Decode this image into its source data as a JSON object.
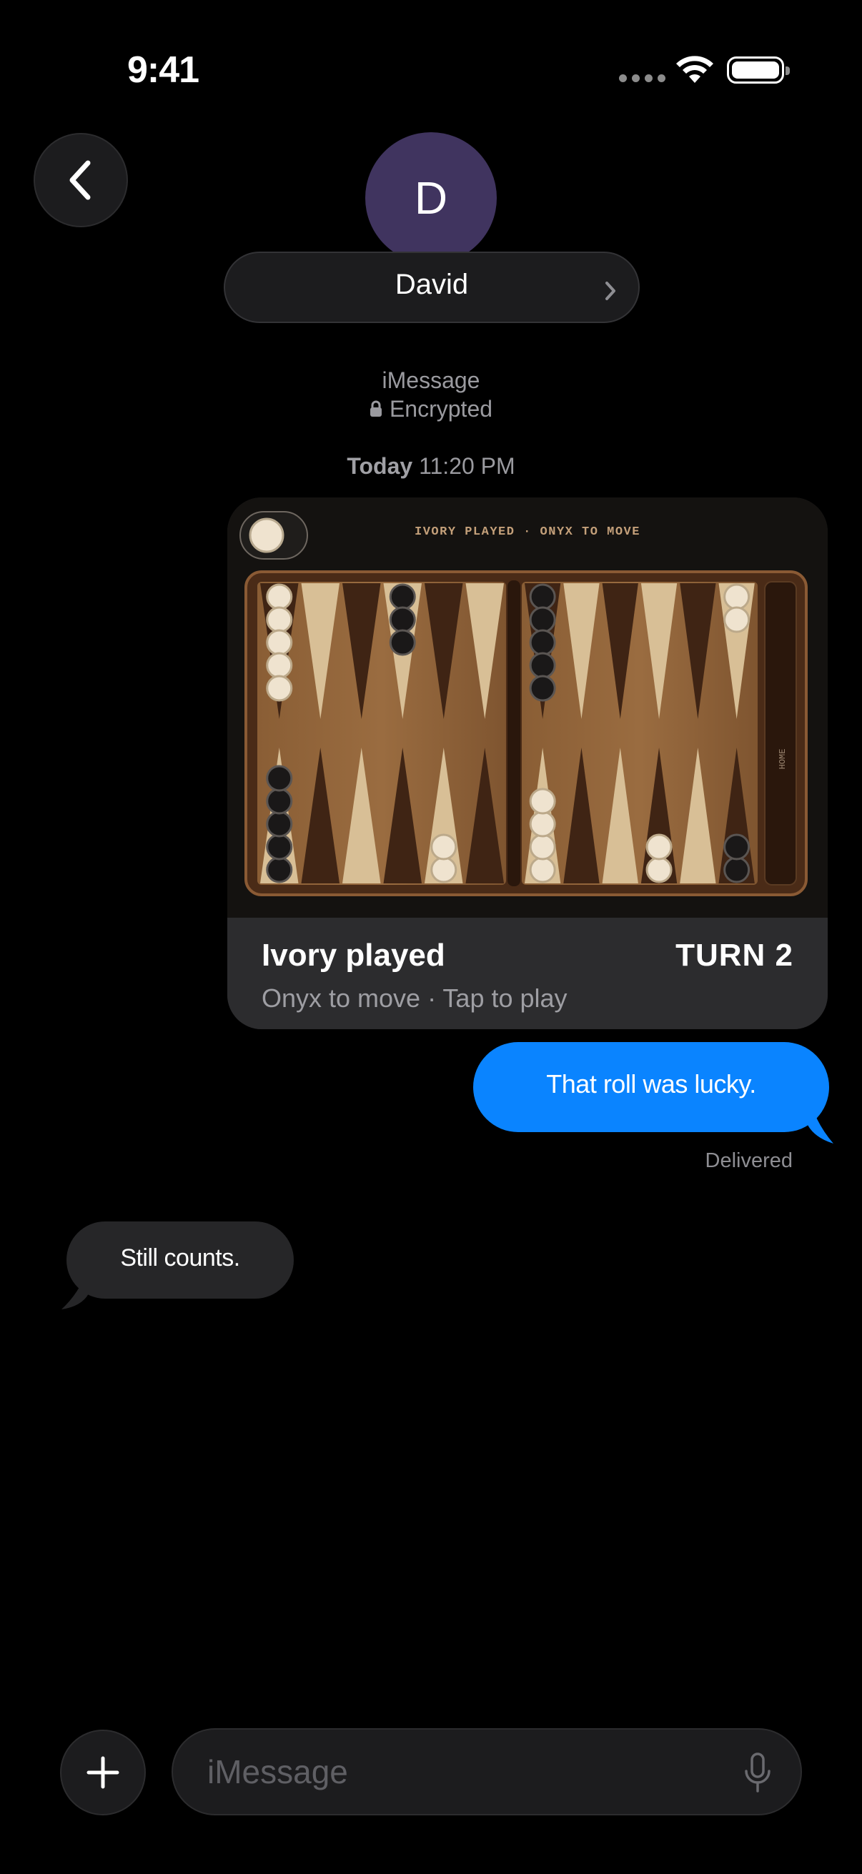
{
  "status_bar": {
    "time": "9:41"
  },
  "header": {
    "avatar_initial": "D",
    "contact_name": "David",
    "avatar_color": "#40345f"
  },
  "conversation": {
    "service": "iMessage",
    "encryption": "Encrypted",
    "timestamp_day": "Today",
    "timestamp_time": "11:20 PM"
  },
  "game_card": {
    "board_caption": "IVORY PLAYED · ONYX TO MOVE",
    "home_label": "HOME",
    "title": "Ivory played",
    "turn": "TURN 2",
    "subtitle": "Onyx to move · Tap to play",
    "board_points": {
      "top": [
        {
          "color": "ivory",
          "count": 5
        },
        {
          "color": "",
          "count": 0
        },
        {
          "color": "",
          "count": 0
        },
        {
          "color": "onyx",
          "count": 3
        },
        {
          "color": "",
          "count": 0
        },
        {
          "color": "",
          "count": 0
        },
        {
          "color": "onyx",
          "count": 5
        },
        {
          "color": "",
          "count": 0
        },
        {
          "color": "",
          "count": 0
        },
        {
          "color": "",
          "count": 0
        },
        {
          "color": "",
          "count": 0
        },
        {
          "color": "ivory",
          "count": 2
        }
      ],
      "bottom": [
        {
          "color": "onyx",
          "count": 5
        },
        {
          "color": "",
          "count": 0
        },
        {
          "color": "",
          "count": 0
        },
        {
          "color": "",
          "count": 0
        },
        {
          "color": "ivory",
          "count": 2
        },
        {
          "color": "",
          "count": 0
        },
        {
          "color": "ivory",
          "count": 4
        },
        {
          "color": "",
          "count": 0
        },
        {
          "color": "",
          "count": 0
        },
        {
          "color": "ivory",
          "count": 2
        },
        {
          "color": "",
          "count": 0
        },
        {
          "color": "onyx",
          "count": 2
        }
      ]
    }
  },
  "messages": [
    {
      "direction": "sent",
      "text": "That roll was lucky.",
      "status": "Delivered"
    },
    {
      "direction": "received",
      "text": "Still counts."
    }
  ],
  "composer": {
    "placeholder": "iMessage"
  },
  "colors": {
    "sent_bubble": "#0a84ff",
    "received_bubble": "#262628",
    "background": "#000000"
  }
}
